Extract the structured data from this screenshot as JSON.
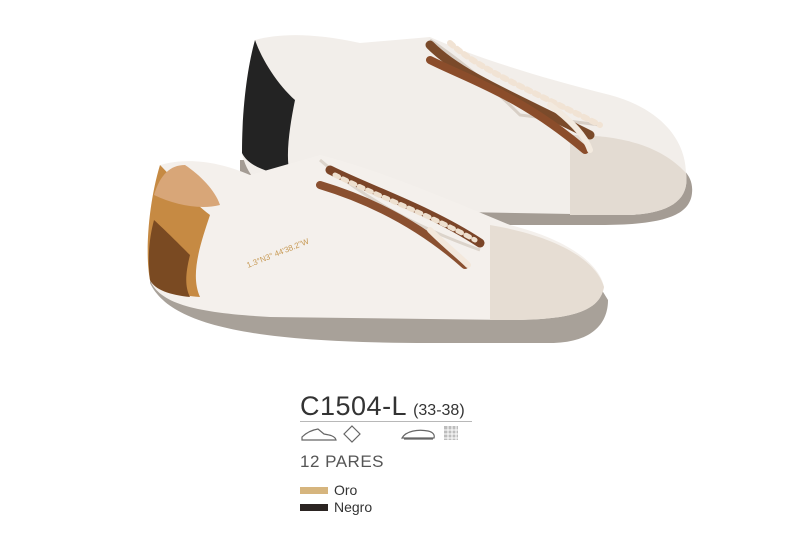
{
  "product": {
    "code": "C1504-L",
    "sizes": "(33-38)",
    "pairs": "12 PARES",
    "shoe_text": "1.3°N3° 44'38.2\"W"
  },
  "icons": [
    "sneaker-outline-icon",
    "diamond-icon",
    "shoe-sole-icon",
    "textile-grid-icon"
  ],
  "colors": [
    {
      "name": "Oro",
      "hex": "#d6b57e"
    },
    {
      "name": "Negro",
      "hex": "#2b2422"
    }
  ]
}
